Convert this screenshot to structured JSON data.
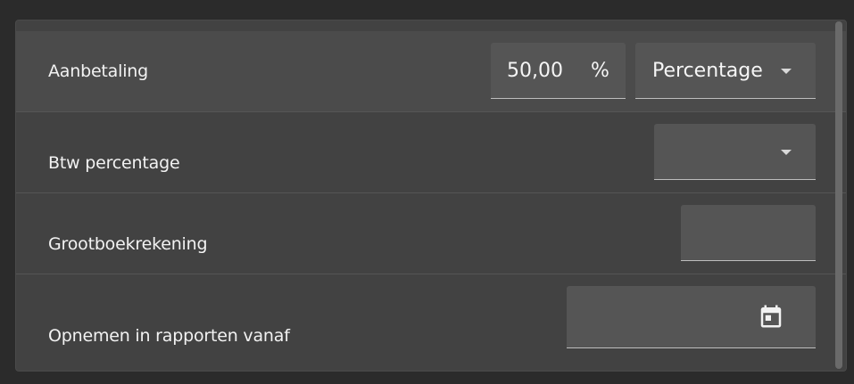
{
  "rows": [
    {
      "label": "Aanbetaling",
      "amount": {
        "value": "50,00",
        "suffix": "%"
      },
      "type_select": {
        "value": "Percentage"
      }
    },
    {
      "label": "Btw percentage",
      "select": {
        "value": ""
      }
    },
    {
      "label": "Grootboekrekening",
      "input": {
        "value": ""
      }
    },
    {
      "label": "Opnemen in rapporten vanaf",
      "date": {
        "value": "",
        "icon": "calendar-icon"
      }
    }
  ],
  "colors": {
    "page_bg": "#2b2b2b",
    "panel_bg": "#424242",
    "highlight_row_bg": "#4b4b4b",
    "field_bg": "#555555",
    "text": "#f2f2f2"
  }
}
